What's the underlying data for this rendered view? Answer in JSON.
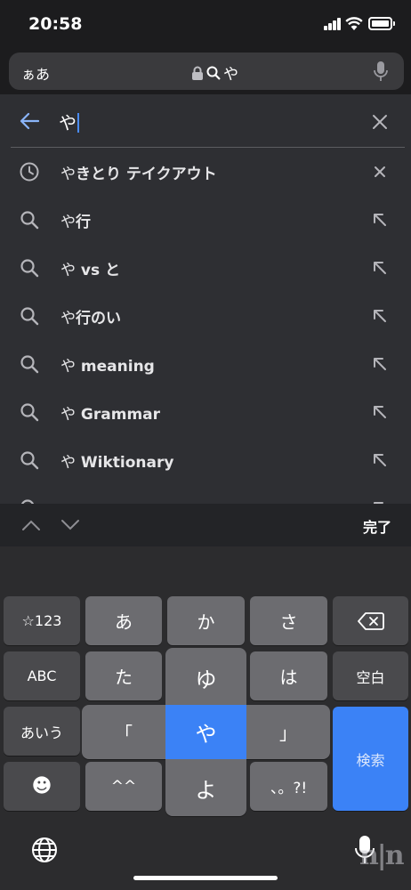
{
  "status": {
    "time": "20:58"
  },
  "address_bar": {
    "text_size_label": "ぁあ",
    "url": "や"
  },
  "search": {
    "query": "や"
  },
  "suggestions": [
    {
      "type": "history",
      "prefix": "や",
      "bold": "きとり テイクアウト",
      "action": "remove"
    },
    {
      "type": "search",
      "prefix": "や",
      "bold": "行",
      "action": "fill"
    },
    {
      "type": "search",
      "prefix": "や",
      "bold": " vs と",
      "action": "fill"
    },
    {
      "type": "search",
      "prefix": "や",
      "bold": "行のい",
      "action": "fill"
    },
    {
      "type": "search",
      "prefix": "や",
      "bold": " meaning",
      "action": "fill"
    },
    {
      "type": "search",
      "prefix": "や",
      "bold": " Grammar",
      "action": "fill"
    },
    {
      "type": "search",
      "prefix": "や",
      "bold": " Wiktionary",
      "action": "fill"
    }
  ],
  "accessory": {
    "done_label": "完了"
  },
  "keyboard": {
    "row1": [
      "☆123",
      "あ",
      "か",
      "さ"
    ],
    "row2": [
      "ABC",
      "た",
      "ゆ",
      "は",
      "空白"
    ],
    "row3": [
      "あいう",
      "「",
      "や",
      "」"
    ],
    "row4": [
      "☻",
      "^^",
      "よ",
      "、。?!"
    ],
    "search_label": "検索"
  },
  "watermark": "n|n",
  "colors": {
    "accent": "#3b82f6",
    "background": "#2e2f33"
  }
}
